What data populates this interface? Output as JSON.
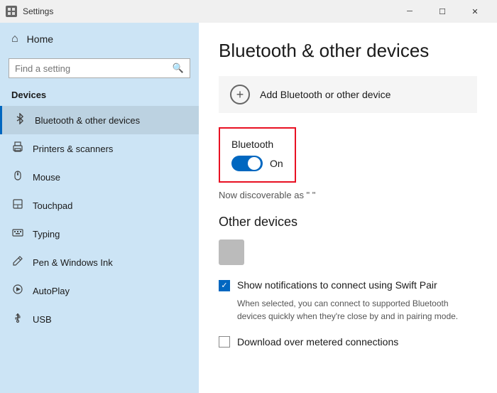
{
  "titleBar": {
    "title": "Settings",
    "minimizeLabel": "─",
    "maximizeLabel": "☐",
    "closeLabel": "✕"
  },
  "sidebar": {
    "homeLabel": "Home",
    "searchPlaceholder": "Find a setting",
    "sectionTitle": "Devices",
    "items": [
      {
        "id": "bluetooth",
        "label": "Bluetooth & other devices",
        "icon": "📶",
        "active": true
      },
      {
        "id": "printers",
        "label": "Printers & scanners",
        "icon": "🖨",
        "active": false
      },
      {
        "id": "mouse",
        "label": "Mouse",
        "icon": "🖱",
        "active": false
      },
      {
        "id": "touchpad",
        "label": "Touchpad",
        "icon": "⬛",
        "active": false
      },
      {
        "id": "typing",
        "label": "Typing",
        "icon": "⌨",
        "active": false
      },
      {
        "id": "pen",
        "label": "Pen & Windows Ink",
        "icon": "✏",
        "active": false
      },
      {
        "id": "autoplay",
        "label": "AutoPlay",
        "icon": "▶",
        "active": false
      },
      {
        "id": "usb",
        "label": "USB",
        "icon": "⚡",
        "active": false
      }
    ]
  },
  "main": {
    "pageTitle": "Bluetooth & other devices",
    "addDeviceLabel": "Add Bluetooth or other device",
    "bluetoothLabel": "Bluetooth",
    "bluetoothToggleState": "On",
    "discoverableText": "Now discoverable as \"                 \"",
    "otherDevicesHeading": "Other devices",
    "swiftPairLabel": "Show notifications to connect using Swift Pair",
    "swiftPairDescription": "When selected, you can connect to supported Bluetooth devices quickly when they're close by and in pairing mode.",
    "downloadLabel": "Download over metered connections"
  }
}
